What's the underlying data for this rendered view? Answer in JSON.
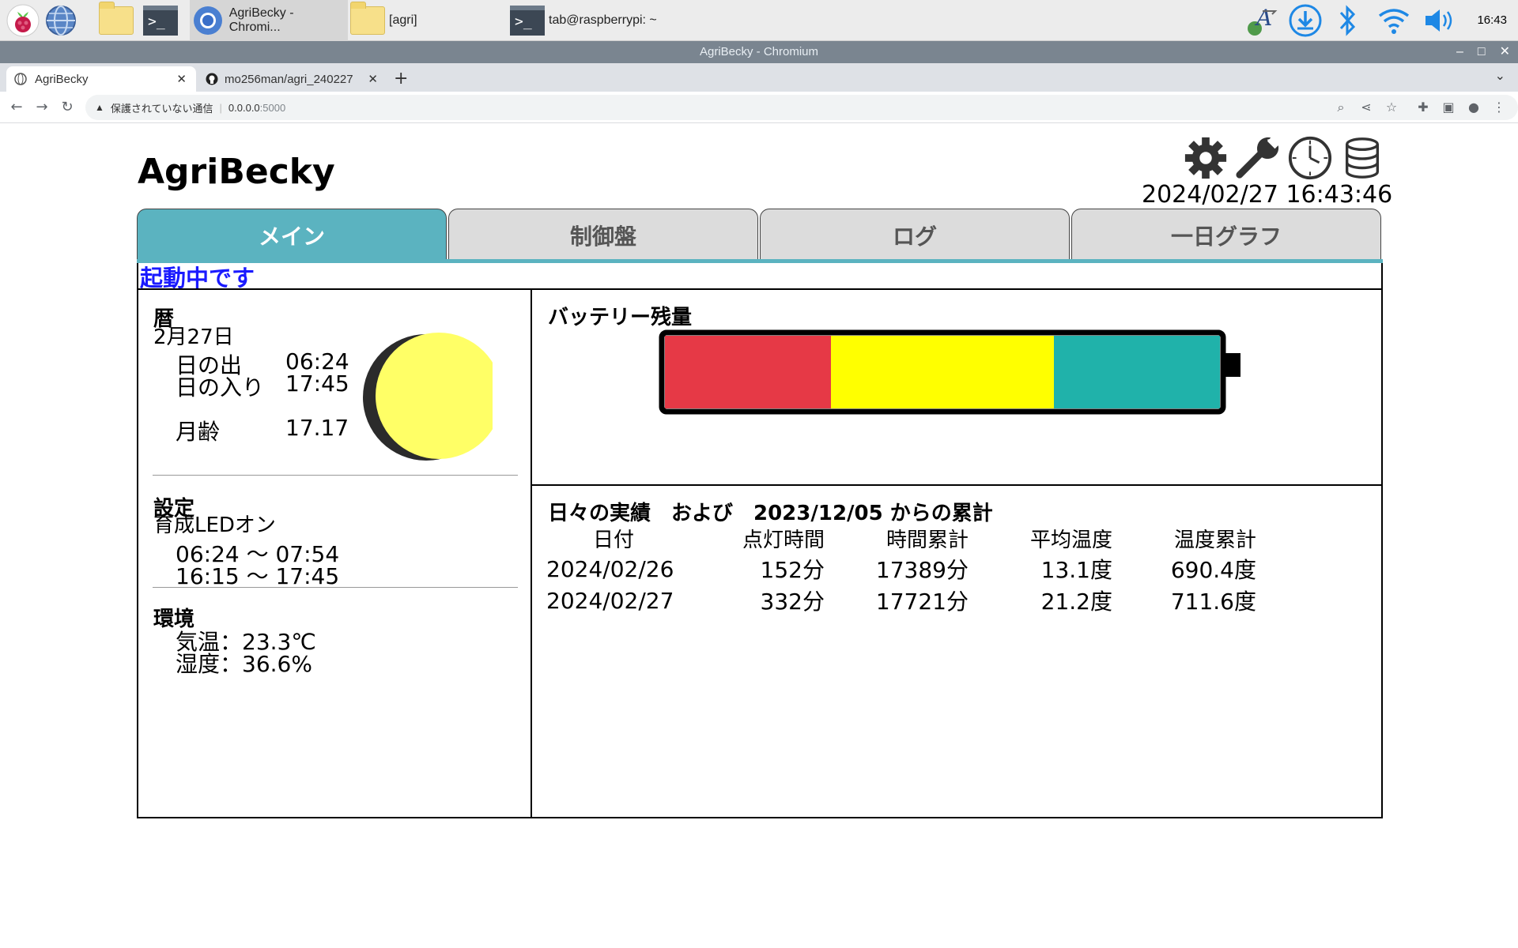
{
  "taskbar": {
    "tasks": [
      {
        "label": "AgriBecky - Chromi...",
        "icon": "chromium-icon"
      },
      {
        "label": "[agri]",
        "icon": "folder-icon"
      },
      {
        "label": "tab@raspberrypi: ~",
        "icon": "terminal-icon"
      }
    ],
    "clock": "16:43"
  },
  "browser": {
    "window_title": "AgriBecky - Chromium",
    "tabs": [
      {
        "title": "AgriBecky"
      },
      {
        "title": "mo256man/agri_240227"
      }
    ],
    "security_label": "保護されていない通信",
    "url_host": "0.0.0.0",
    "url_port": ":5000"
  },
  "app": {
    "title": "AgriBecky",
    "datetime": "2024/02/27 16:43:46",
    "header_icons": [
      "gear-icon",
      "wrench-icon",
      "clock-icon",
      "database-icon"
    ],
    "tabs": [
      "メイン",
      "制御盤",
      "ログ",
      "一日グラフ"
    ],
    "status": "起動中です",
    "calendar": {
      "heading": "暦",
      "date": "2月27日",
      "sunrise_label": "日の出",
      "sunrise": "06:24",
      "sunset_label": "日の入り",
      "sunset": "17:45",
      "moon_age_label": "月齢",
      "moon_age": "17.17"
    },
    "settings": {
      "heading": "設定",
      "led": "育成LEDオン",
      "period1": "06:24 ～ 07:54",
      "period2": "16:15 ～ 17:45"
    },
    "environment": {
      "heading": "環境",
      "temp": "気温：23.3℃",
      "humidity": "湿度：36.6%"
    },
    "battery": {
      "heading": "バッテリー残量",
      "colors": [
        "#e63946",
        "#ffff00",
        "#20b2aa"
      ]
    },
    "daily": {
      "heading": "日々の実績　および　2023/12/05 からの累計",
      "columns": [
        "日付",
        "点灯時間",
        "時間累計",
        "平均温度",
        "温度累計"
      ],
      "rows": [
        [
          "2024/02/26",
          "152分",
          "17389分",
          "13.1度",
          "690.4度"
        ],
        [
          "2024/02/27",
          "332分",
          "17721分",
          "21.2度",
          "711.6度"
        ]
      ]
    }
  }
}
